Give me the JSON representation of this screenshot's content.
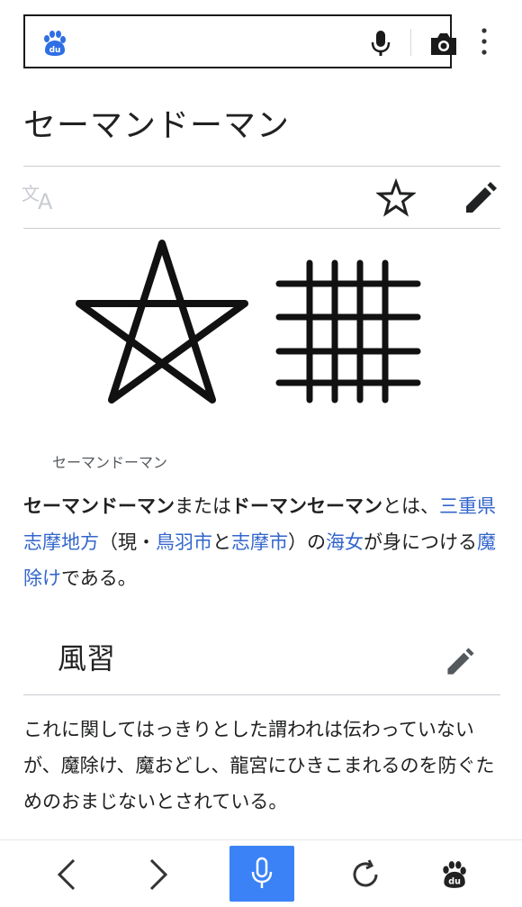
{
  "title": "セーマンドーマン",
  "caption": "セーマンドーマン",
  "intro": {
    "b1": "セーマンドーマン",
    "t1": "または",
    "b2": "ドーマンセーマン",
    "t2": "とは、",
    "l1": "三重県",
    "l2": "志摩地方",
    "t3": "（現・",
    "l3": "鳥羽市",
    "t4": "と",
    "l4": "志摩市",
    "t5": "）の",
    "l5": "海女",
    "t6": "が身につける",
    "l6": "魔除け",
    "t7": "である。"
  },
  "section": {
    "title": "風習",
    "body": "これに関してはっきりとした謂われは伝わっていないが、魔除け、魔おどし、龍宮にひきこまれるのを防ぐためのおまじないとされている。"
  },
  "icons": {
    "logo": "baidu-paw-icon",
    "mic": "microphone-icon",
    "camera": "camera-icon",
    "menu": "more-vertical-icon",
    "language": "translate-icon",
    "watch": "star-outline-icon",
    "edit": "pencil-icon",
    "back": "chevron-left-icon",
    "forward": "chevron-right-icon",
    "voice": "microphone-icon",
    "refresh": "refresh-icon",
    "home": "baidu-paw-icon"
  },
  "colors": {
    "link": "#3366cc",
    "accent": "#3b82f6",
    "text": "#202122"
  }
}
